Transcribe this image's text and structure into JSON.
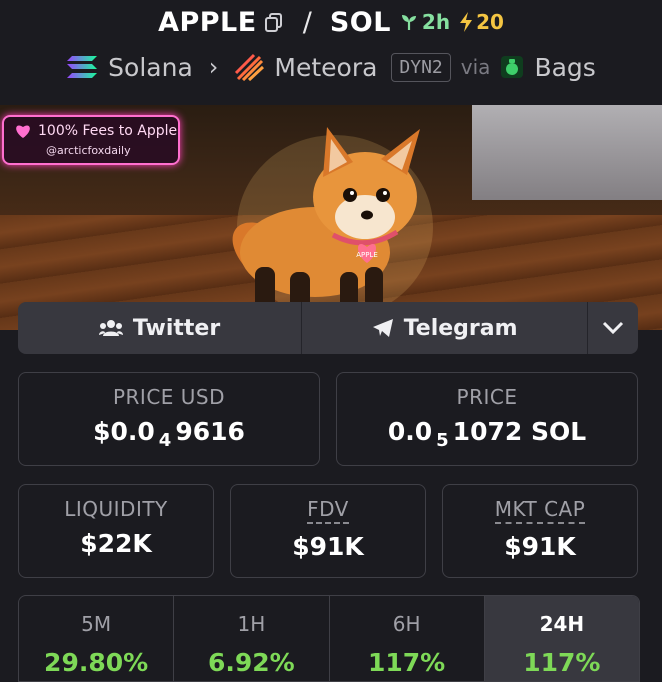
{
  "header": {
    "base_token": "APPLE",
    "separator": "/",
    "quote_token": "SOL",
    "age": "2h",
    "boosts": "20"
  },
  "chain": {
    "network": "Solana",
    "dex": "Meteora",
    "pool_type": "DYN2",
    "via": "via",
    "launchpad": "Bags"
  },
  "banner": {
    "fees_text": "100% Fees to Apple",
    "handle": "@arcticfoxdaily",
    "tag_text": "APPLE"
  },
  "social": {
    "twitter_label": "Twitter",
    "telegram_label": "Telegram"
  },
  "stats": {
    "price_usd_label": "PRICE USD",
    "price_usd_prefix": "$0.0",
    "price_usd_zeros": "4",
    "price_usd_digits": "9616",
    "price_label": "PRICE",
    "price_prefix": "0.0",
    "price_zeros": "5",
    "price_digits": "1072 SOL",
    "liquidity_label": "LIQUIDITY",
    "liquidity_value": "$22K",
    "fdv_label": "FDV",
    "fdv_value": "$91K",
    "mktcap_label": "MKT CAP",
    "mktcap_value": "$91K"
  },
  "timeframes": [
    {
      "label": "5M",
      "value": "29.80%"
    },
    {
      "label": "1H",
      "value": "6.92%"
    },
    {
      "label": "6H",
      "value": "117%"
    },
    {
      "label": "24H",
      "value": "117%"
    }
  ],
  "colors": {
    "positive": "#7ed957",
    "age": "#86e0a0",
    "boost": "#f4c542",
    "fees_badge": "#ff6fcf"
  }
}
